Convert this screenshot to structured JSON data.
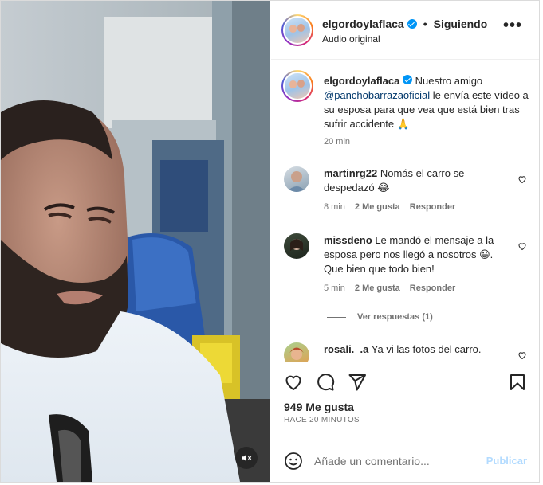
{
  "header": {
    "username": "elgordoylaflaca",
    "separator": "•",
    "follow_status": "Siguiendo",
    "audio": "Audio original",
    "more": "•••"
  },
  "caption": {
    "username": "elgordoylaflaca",
    "text_before": "Nuestro amigo",
    "mention": "@panchobarrazaoficial",
    "text_after": "le envía este vídeo a su esposa para que vea que está bien tras sufrir accidente 🙏",
    "time": "20 min"
  },
  "comments": [
    {
      "username": "martinrg22",
      "text": "Nomás el carro se despedazó 😂",
      "time": "8 min",
      "likes": "2 Me gusta",
      "reply": "Responder"
    },
    {
      "username": "missdeno",
      "text": "Le mandó el mensaje a la esposa pero nos llegó a nosotros 😀. Que bien que todo bien!",
      "time": "5 min",
      "likes": "2 Me gusta",
      "reply": "Responder"
    },
    {
      "username": "rosali._.a",
      "text": "Ya vi las fotos del carro.",
      "time": "",
      "likes": "",
      "reply": ""
    }
  ],
  "view_replies": "Ver respuestas (1)",
  "actions": {
    "likes_count": "949 Me gusta",
    "posted_ago": "HACE 20 MINUTOS"
  },
  "add_comment": {
    "placeholder": "Añade un comentario...",
    "publish": "Publicar"
  },
  "icons": {
    "verified": "verified-badge-icon",
    "mute": "muted-speaker-icon",
    "like": "heart-icon",
    "comment": "comment-bubble-icon",
    "share": "paper-plane-icon",
    "save": "bookmark-icon",
    "emoji": "smiley-icon"
  },
  "colors": {
    "verified": "#0095f6",
    "mention": "#00376b",
    "publish_disabled": "#b3dbff",
    "muted_text": "#737373"
  }
}
